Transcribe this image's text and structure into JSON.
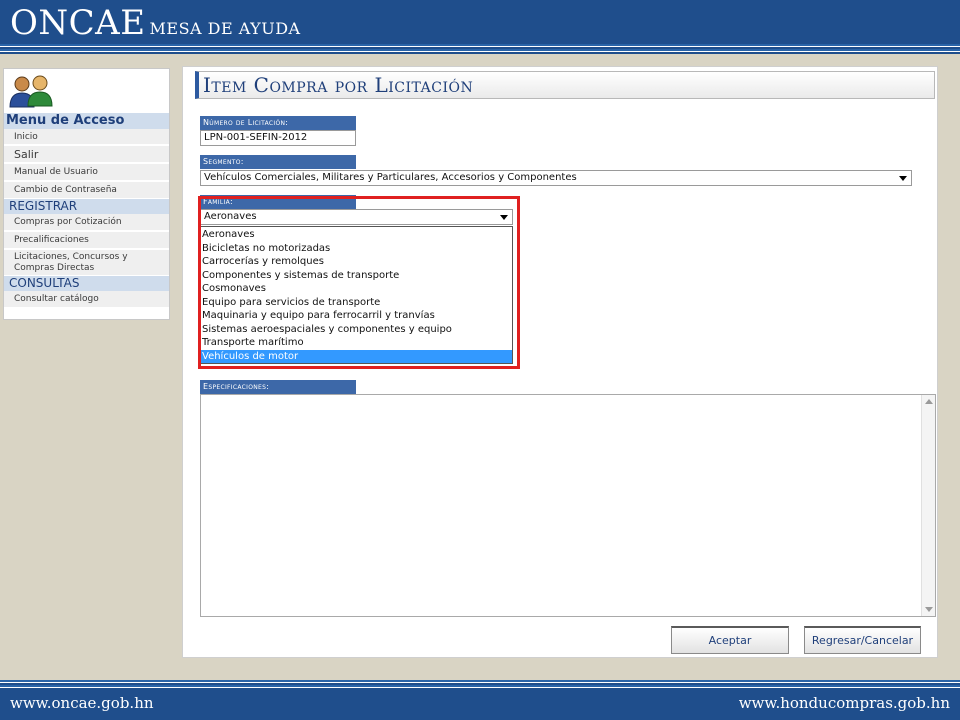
{
  "header": {
    "brand": "ONCAE",
    "subtitle": "MESA DE AYUDA"
  },
  "footer": {
    "left_url": "www.oncae.gob.hn",
    "right_url": "www.honducompras.gob.hn"
  },
  "sidebar": {
    "menu_title": "Menu de Acceso",
    "items": [
      "Inicio",
      "Salir",
      "Manual de Usuario",
      "Cambio de Contraseña"
    ],
    "registrar_title": "REGISTRAR",
    "registrar_items": [
      "Compras por Cotización",
      "Precalificaciones",
      "Licitaciones, Concursos y Compras Directas"
    ],
    "consultas_title": "CONSULTAS",
    "consultas_items": [
      "Consultar catálogo"
    ]
  },
  "main": {
    "title": "Item Compra por Licitación",
    "licitacion": {
      "label": "Número de Licitación:",
      "value": "LPN-001-SEFIN-2012"
    },
    "segmento": {
      "label": "Segmento:",
      "value": "Vehículos Comerciales, Militares y Particulares, Accesorios y Componentes"
    },
    "familia": {
      "label": "Familia:",
      "value": "Aeronaves",
      "options": [
        "Aeronaves",
        "Bicicletas no motorizadas",
        "Carrocerías y remolques",
        "Componentes y sistemas de transporte",
        "Cosmonaves",
        "Equipo para servicios de transporte",
        "Maquinaria y equipo para ferrocarril y tranvías",
        "Sistemas aeroespaciales y componentes y equipo",
        "Transporte marítimo",
        "Vehículos de motor"
      ],
      "highlighted_option": "Vehículos de motor"
    },
    "especificaciones": {
      "label": "Especificaciones:",
      "value": ""
    },
    "buttons": {
      "accept": "Aceptar",
      "cancel": "Regresar/Cancelar"
    }
  },
  "colors": {
    "header_blue": "#1f4e8c",
    "label_blue": "#3d68a8",
    "highlight_red": "#e02020",
    "selection_blue": "#3399ff"
  }
}
